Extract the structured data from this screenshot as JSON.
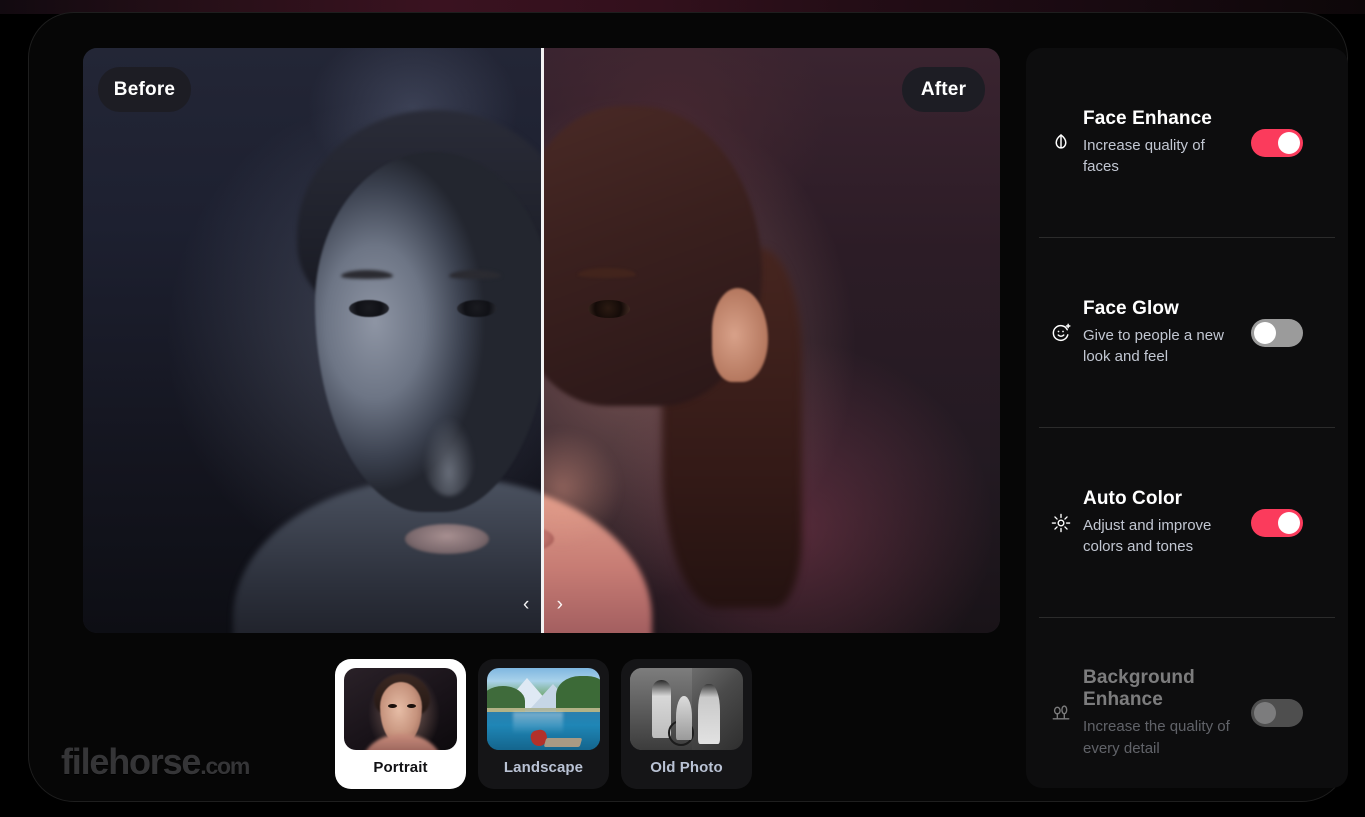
{
  "preview": {
    "before_label": "Before",
    "after_label": "After",
    "prev_chevron": "‹",
    "next_chevron": "›"
  },
  "watermark": {
    "name": "filehorse",
    "tld": ".com"
  },
  "thumbnails": [
    {
      "label": "Portrait",
      "selected": true,
      "icon": "portrait-thumbnail"
    },
    {
      "label": "Landscape",
      "selected": false,
      "icon": "landscape-thumbnail"
    },
    {
      "label": "Old Photo",
      "selected": false,
      "icon": "old-photo-thumbnail"
    }
  ],
  "panel": {
    "options": [
      {
        "title": "Face Enhance",
        "description": "Increase quality of faces",
        "icon": "face-enhance-icon",
        "enabled": true,
        "toggle_on": true
      },
      {
        "title": "Face Glow",
        "description": "Give to people a new look and feel",
        "icon": "face-glow-icon",
        "enabled": true,
        "toggle_on": false
      },
      {
        "title": "Auto Color",
        "description": "Adjust and improve colors and tones",
        "icon": "auto-color-icon",
        "enabled": true,
        "toggle_on": true
      },
      {
        "title": "Background Enhance",
        "description": "Increase the quality of every detail",
        "icon": "background-enhance-icon",
        "enabled": false,
        "toggle_on": false
      }
    ]
  },
  "colors": {
    "accent_on": "#fb3b5c",
    "toggle_off": "#9b9b9b",
    "panel_bg": "#0d0d0e",
    "app_bg": "#000000",
    "title_text": "#ffffff",
    "desc_text": "#c2c7d2",
    "thumb_label": "#b9c2d4"
  }
}
